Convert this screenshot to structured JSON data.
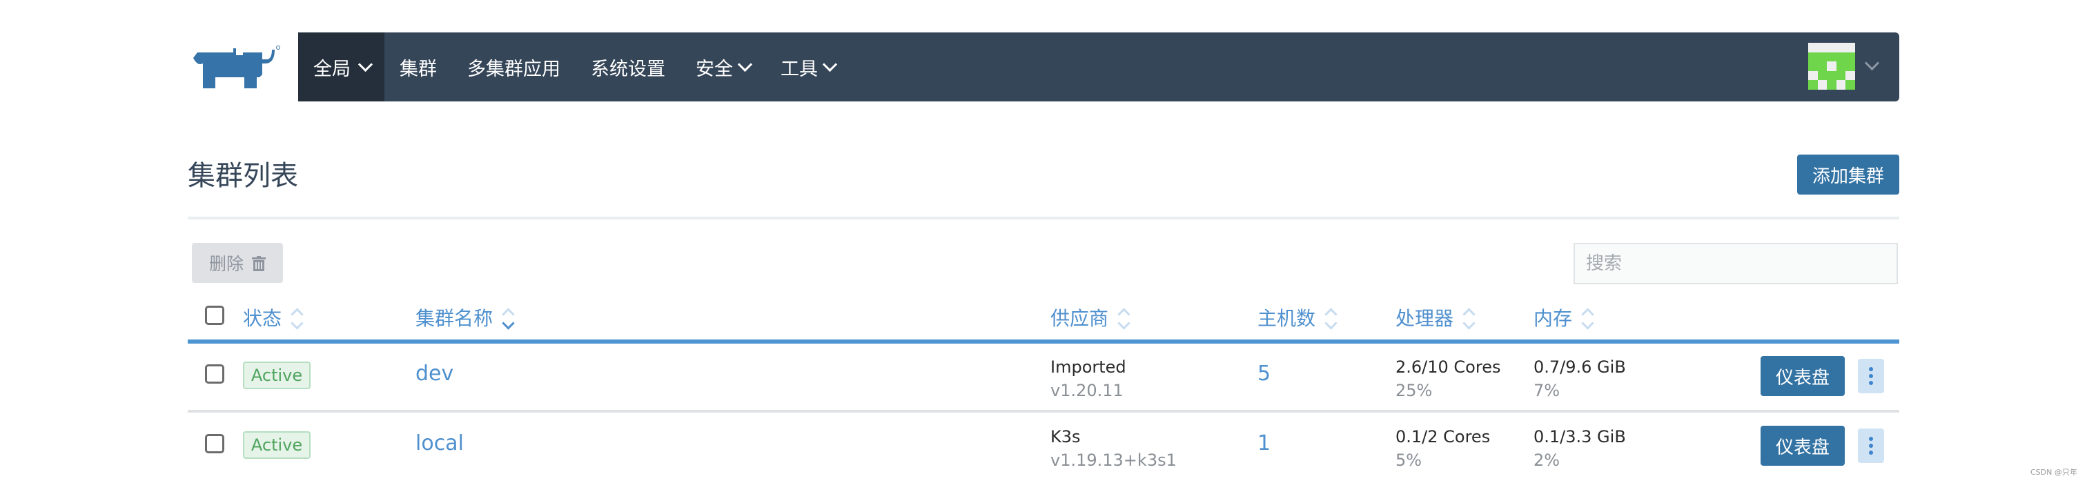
{
  "header": {
    "logo": "rancher-logo",
    "nav": [
      {
        "label": "全局",
        "dropdown": true,
        "active": true
      },
      {
        "label": "集群",
        "dropdown": false
      },
      {
        "label": "多集群应用",
        "dropdown": false
      },
      {
        "label": "系统设置",
        "dropdown": false
      },
      {
        "label": "安全",
        "dropdown": true
      },
      {
        "label": "工具",
        "dropdown": true
      }
    ],
    "avatar": {
      "colors": {
        "fg": "#6fd64c",
        "bg": "#efefef"
      },
      "pattern": [
        [
          0,
          0,
          0,
          0,
          0
        ],
        [
          1,
          1,
          1,
          1,
          1
        ],
        [
          1,
          1,
          0,
          1,
          1
        ],
        [
          0,
          1,
          1,
          1,
          0
        ],
        [
          1,
          0,
          1,
          0,
          1
        ]
      ]
    }
  },
  "page": {
    "title": "集群列表",
    "add_button": "添加集群",
    "delete_button": "删除",
    "search_placeholder": "搜索",
    "search_value": ""
  },
  "table": {
    "columns": [
      {
        "label": "状态",
        "sort": "none"
      },
      {
        "label": "集群名称",
        "sort": "desc"
      },
      {
        "label": "供应商",
        "sort": "none"
      },
      {
        "label": "主机数",
        "sort": "none"
      },
      {
        "label": "处理器",
        "sort": "none"
      },
      {
        "label": "内存",
        "sort": "none"
      }
    ],
    "rows": [
      {
        "status": "Active",
        "name": "dev",
        "provider": "Imported",
        "version": "v1.20.11",
        "hosts": "5",
        "cpu": "2.6/10 Cores",
        "cpu_pct": "25%",
        "mem": "0.7/9.6 GiB",
        "mem_pct": "7%",
        "action": "仪表盘"
      },
      {
        "status": "Active",
        "name": "local",
        "provider": "K3s",
        "version": "v1.19.13+k3s1",
        "hosts": "1",
        "cpu": "0.1/2 Cores",
        "cpu_pct": "5%",
        "mem": "0.1/3.3 GiB",
        "mem_pct": "2%",
        "action": "仪表盘"
      }
    ]
  },
  "colors": {
    "nav_bg": "#364659",
    "nav_active_bg": "#252f3c",
    "primary": "#3373a4",
    "link": "#4f90ce",
    "active_badge": "#4fa45e"
  },
  "watermark": "CSDN @只年"
}
